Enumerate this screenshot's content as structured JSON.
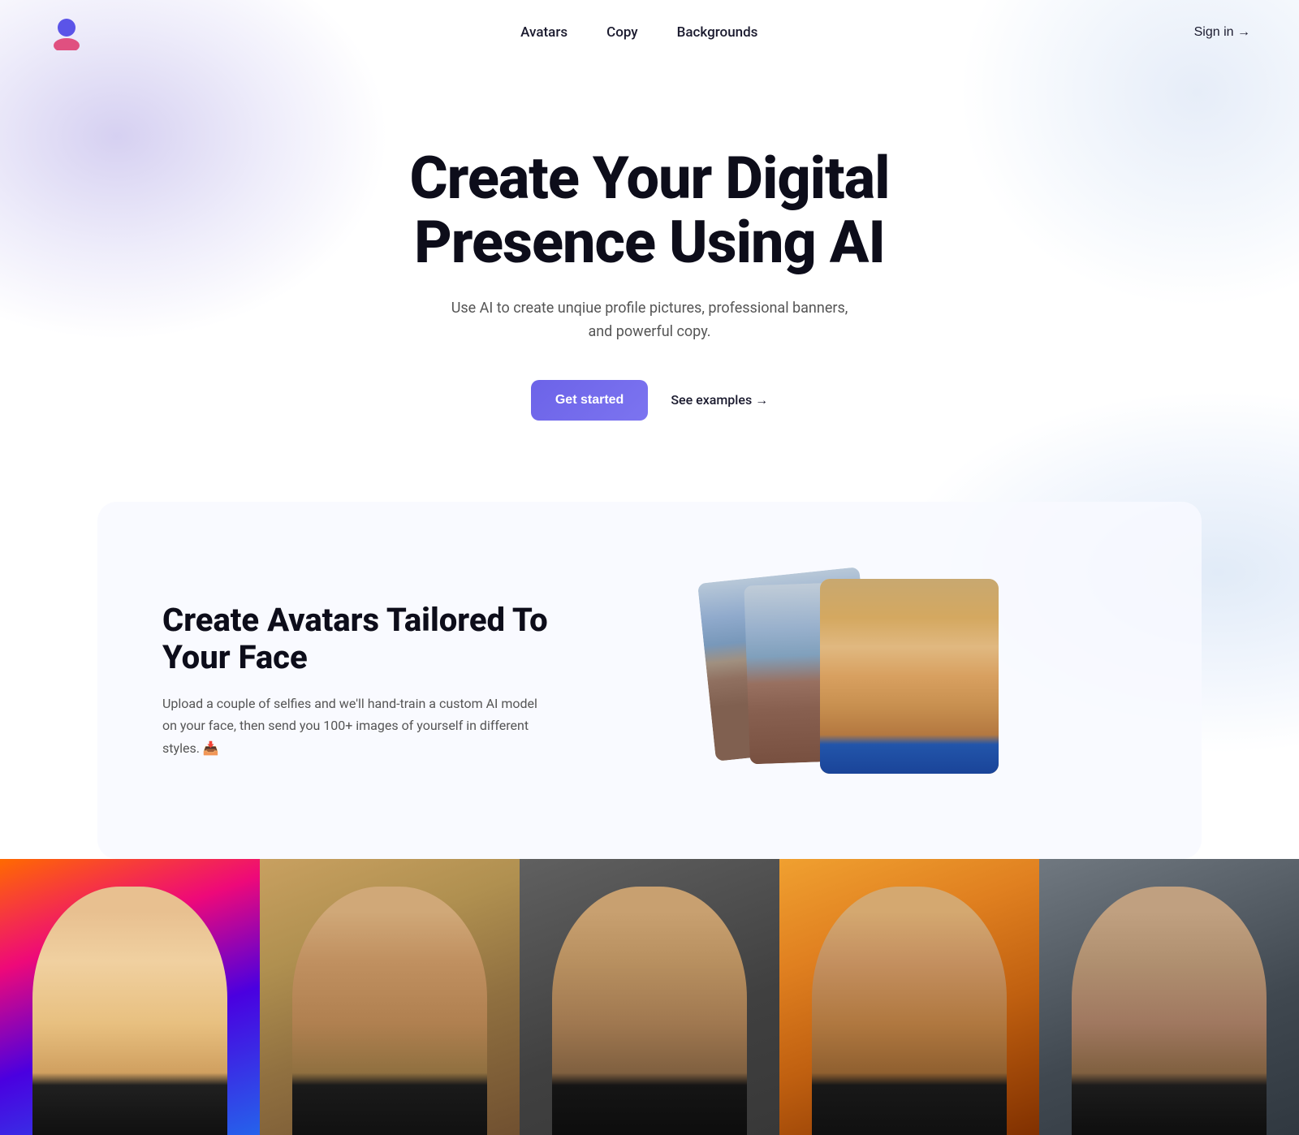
{
  "nav": {
    "logo_alt": "AI Avatar App Logo",
    "links": [
      {
        "id": "avatars",
        "label": "Avatars"
      },
      {
        "id": "copy",
        "label": "Copy"
      },
      {
        "id": "backgrounds",
        "label": "Backgrounds"
      }
    ],
    "sign_in_label": "Sign in →"
  },
  "hero": {
    "title": "Create Your Digital Presence Using AI",
    "subtitle": "Use AI to create unqiue profile pictures, professional banners, and powerful copy.",
    "cta_primary": "Get started",
    "cta_secondary": "See examples →"
  },
  "feature": {
    "title": "Create Avatars Tailored To Your Face",
    "description": "Upload a couple of selfies and we'll hand-train a custom AI model on your face, then send you 100+ images of yourself in different styles. 📥"
  },
  "gallery": {
    "items": [
      {
        "id": 1,
        "alt": "Avatar with colorful gradient"
      },
      {
        "id": 2,
        "alt": "Avatar with warm tones"
      },
      {
        "id": 3,
        "alt": "Avatar in dark style"
      },
      {
        "id": 4,
        "alt": "Avatar with orange lighting"
      },
      {
        "id": 5,
        "alt": "Avatar in dark professional style"
      }
    ]
  }
}
